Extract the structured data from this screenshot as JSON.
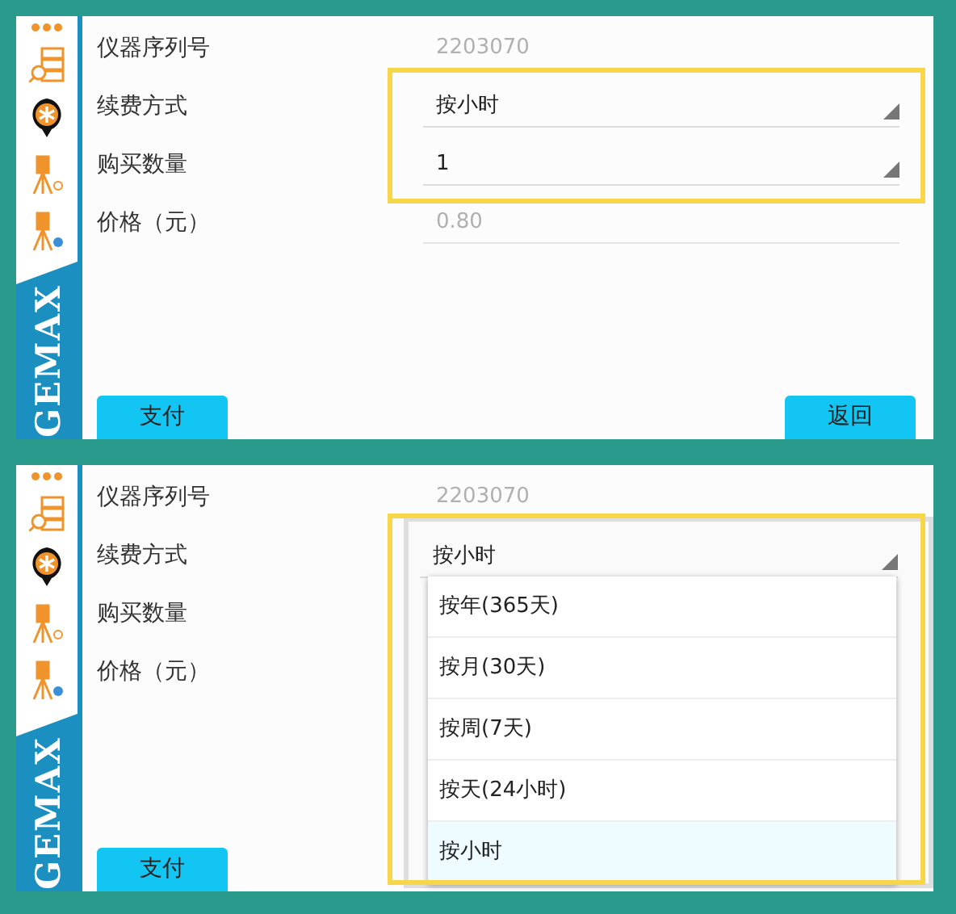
{
  "panels": [
    {
      "logo": "GEMAX",
      "highlighted": true,
      "fields": [
        {
          "label": "仪器序列号",
          "kind": "readonly",
          "value": "2203070"
        },
        {
          "label": "续费方式",
          "kind": "select",
          "value": "按小时"
        },
        {
          "label": "购买数量",
          "kind": "select",
          "value": "1"
        },
        {
          "label": "价格（元）",
          "kind": "readonly",
          "value": "0.80"
        }
      ],
      "buttons": [
        "支付",
        "返回"
      ]
    },
    {
      "logo": "GEMAX",
      "highlighted": true,
      "fields": [
        {
          "label": "仪器序列号",
          "kind": "readonly",
          "value": "2203070"
        },
        {
          "label": "续费方式",
          "kind": "select",
          "value": "按小时"
        },
        {
          "label": "购买数量",
          "kind": "select"
        },
        {
          "label": "价格（元）",
          "kind": "readonly"
        }
      ],
      "buttons": [
        "支付"
      ],
      "dropdown": {
        "options": [
          {
            "label": "按年(365天)",
            "selected": false
          },
          {
            "label": "按月(30天)",
            "selected": false
          },
          {
            "label": "按周(7天)",
            "selected": false
          },
          {
            "label": "按天(24小时)",
            "selected": false
          },
          {
            "label": "按小时",
            "selected": true
          }
        ]
      }
    }
  ]
}
